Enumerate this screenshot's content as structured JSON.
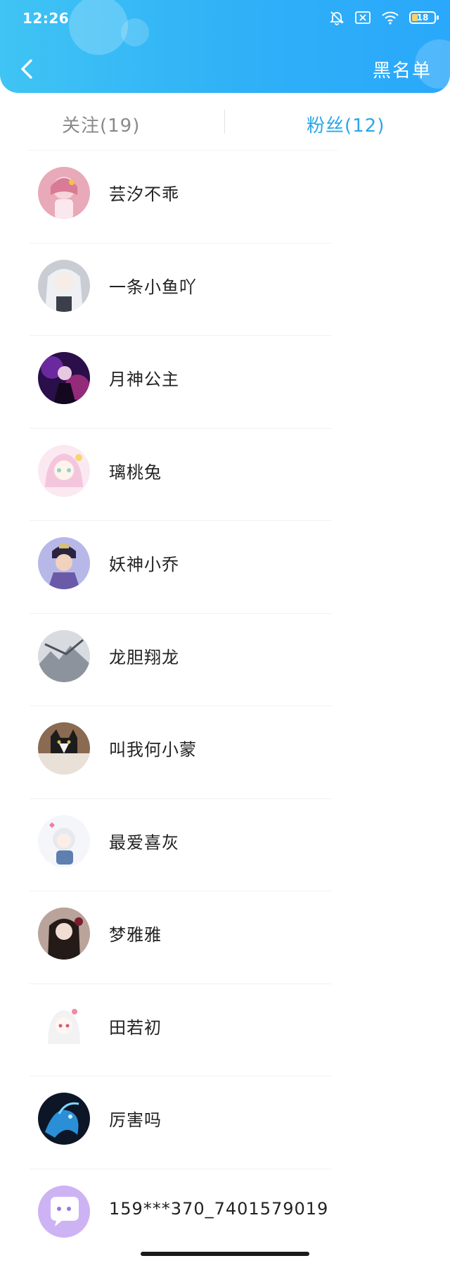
{
  "status_bar": {
    "time": "12:26",
    "battery_level": "18",
    "icons": [
      "bell-muted-icon",
      "sim-x-icon",
      "wifi-icon",
      "battery-icon"
    ]
  },
  "header": {
    "back_icon": "chevron-left-icon",
    "blacklist_label": "黑名单"
  },
  "tabs": [
    {
      "label": "关注(19)",
      "active": false
    },
    {
      "label": "粉丝(12)",
      "active": true
    }
  ],
  "colors": {
    "header_gradient_start": "#3fc4f4",
    "header_gradient_end": "#2aa8fb",
    "active_tab": "#2aa7e8",
    "inactive_tab": "#8a8a8a"
  },
  "fans": [
    {
      "name": "芸汐不乖",
      "avatar_icon": "pink-anime-girl-avatar"
    },
    {
      "name": "一条小鱼吖",
      "avatar_icon": "silver-hair-anime-avatar"
    },
    {
      "name": "月神公主",
      "avatar_icon": "purple-dark-character-avatar"
    },
    {
      "name": "璃桃兔",
      "avatar_icon": "pastel-anime-girl-avatar"
    },
    {
      "name": "妖神小乔",
      "avatar_icon": "costume-actor-avatar"
    },
    {
      "name": "龙胆翔龙",
      "avatar_icon": "grey-landscape-avatar"
    },
    {
      "name": "叫我何小蒙",
      "avatar_icon": "black-white-cat-avatar"
    },
    {
      "name": "最爱喜灰",
      "avatar_icon": "chibi-anime-avatar"
    },
    {
      "name": "梦雅雅",
      "avatar_icon": "dark-hair-girl-avatar"
    },
    {
      "name": "田若初",
      "avatar_icon": "white-hair-anime-girl-avatar"
    },
    {
      "name": "厉害吗",
      "avatar_icon": "blue-dragon-avatar"
    },
    {
      "name": "159***370_7401579019",
      "avatar_icon": "default-chat-bubble-avatar"
    }
  ]
}
